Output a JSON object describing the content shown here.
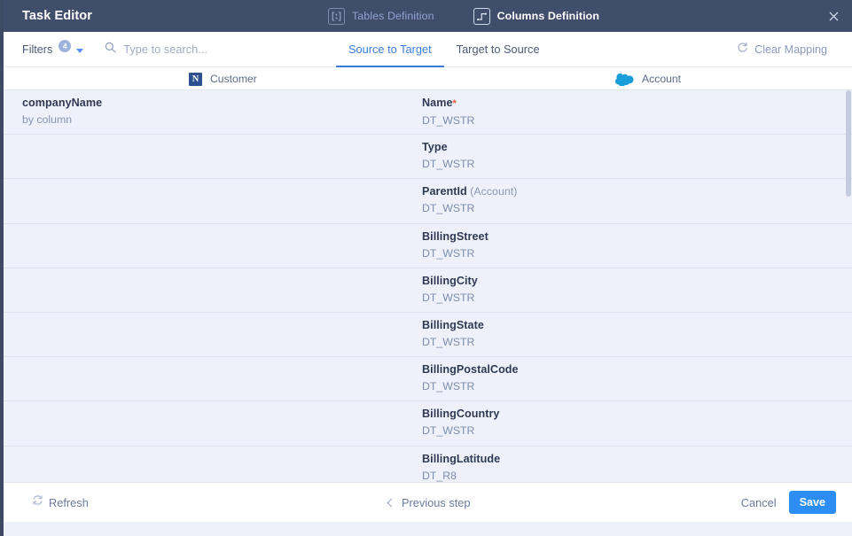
{
  "window": {
    "title": "Task Editor",
    "close_icon": "close-icon"
  },
  "header_tabs": [
    {
      "label": "Tables Definition",
      "icon": "tables-definition-icon",
      "active": false
    },
    {
      "label": "Columns Definition",
      "icon": "columns-definition-icon",
      "active": true
    }
  ],
  "toolbar": {
    "filters_label": "Filters",
    "filters_badge": "4",
    "filters_chevron_icon": "chevron-down-icon",
    "search_icon": "search-icon",
    "search_placeholder": "Type to search...",
    "search_value": "",
    "clear_mapping_label": "Clear Mapping",
    "clear_mapping_icon": "refresh-icon"
  },
  "mode_tabs": [
    {
      "label": "Source to Target",
      "active": true
    },
    {
      "label": "Target to Source",
      "active": false
    }
  ],
  "columns": {
    "source": {
      "label": "Customer",
      "icon": "netezza-icon"
    },
    "target": {
      "label": "Account",
      "icon": "salesforce-cloud-icon"
    }
  },
  "rows": [
    {
      "source": {
        "name": "companyName",
        "sub": "by column"
      },
      "target": {
        "name": "Name",
        "required": true,
        "suffix": "",
        "type": "DT_WSTR"
      }
    },
    {
      "source": {
        "name": "",
        "sub": ""
      },
      "target": {
        "name": "Type",
        "required": false,
        "suffix": "",
        "type": "DT_WSTR"
      }
    },
    {
      "source": {
        "name": "",
        "sub": ""
      },
      "target": {
        "name": "ParentId",
        "required": false,
        "suffix": "(Account)",
        "type": "DT_WSTR"
      }
    },
    {
      "source": {
        "name": "",
        "sub": ""
      },
      "target": {
        "name": "BillingStreet",
        "required": false,
        "suffix": "",
        "type": "DT_WSTR"
      }
    },
    {
      "source": {
        "name": "",
        "sub": ""
      },
      "target": {
        "name": "BillingCity",
        "required": false,
        "suffix": "",
        "type": "DT_WSTR"
      }
    },
    {
      "source": {
        "name": "",
        "sub": ""
      },
      "target": {
        "name": "BillingState",
        "required": false,
        "suffix": "",
        "type": "DT_WSTR"
      }
    },
    {
      "source": {
        "name": "",
        "sub": ""
      },
      "target": {
        "name": "BillingPostalCode",
        "required": false,
        "suffix": "",
        "type": "DT_WSTR"
      }
    },
    {
      "source": {
        "name": "",
        "sub": ""
      },
      "target": {
        "name": "BillingCountry",
        "required": false,
        "suffix": "",
        "type": "DT_WSTR"
      }
    },
    {
      "source": {
        "name": "",
        "sub": ""
      },
      "target": {
        "name": "BillingLatitude",
        "required": false,
        "suffix": "",
        "type": "DT_R8"
      }
    }
  ],
  "footer": {
    "refresh_label": "Refresh",
    "refresh_icon": "refresh-icon",
    "previous_step_label": "Previous step",
    "previous_step_icon": "chevron-left-icon",
    "cancel_label": "Cancel",
    "save_label": "Save"
  },
  "colors": {
    "header_bg": "#414e6b",
    "accent_blue": "#3b7ddd",
    "save_blue": "#2c8ef4",
    "required_red": "#e8543f",
    "body_bg": "#eef1f9"
  }
}
